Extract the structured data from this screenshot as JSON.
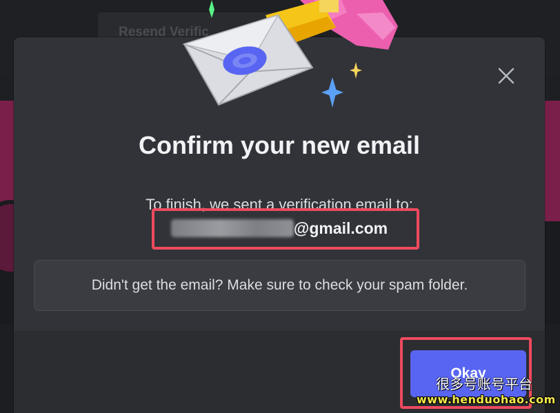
{
  "background": {
    "tab_label": "Resend Verific"
  },
  "modal": {
    "title": "Confirm your new email",
    "subtitle": "To finish, we sent a verification email to:",
    "email_domain": "@gmail.com",
    "info_text": "Didn't get the email? Make sure to check your spam folder.",
    "okay_label": "Okay",
    "close_icon": "close-x-icon"
  },
  "colors": {
    "modal_bg": "#313338",
    "footer_bg": "#2b2d31",
    "accent": "#5865f2",
    "annotation": "#ef4a5e"
  },
  "watermark": {
    "line1": "很多号账号平台",
    "line2": "www.henduohao.com"
  }
}
